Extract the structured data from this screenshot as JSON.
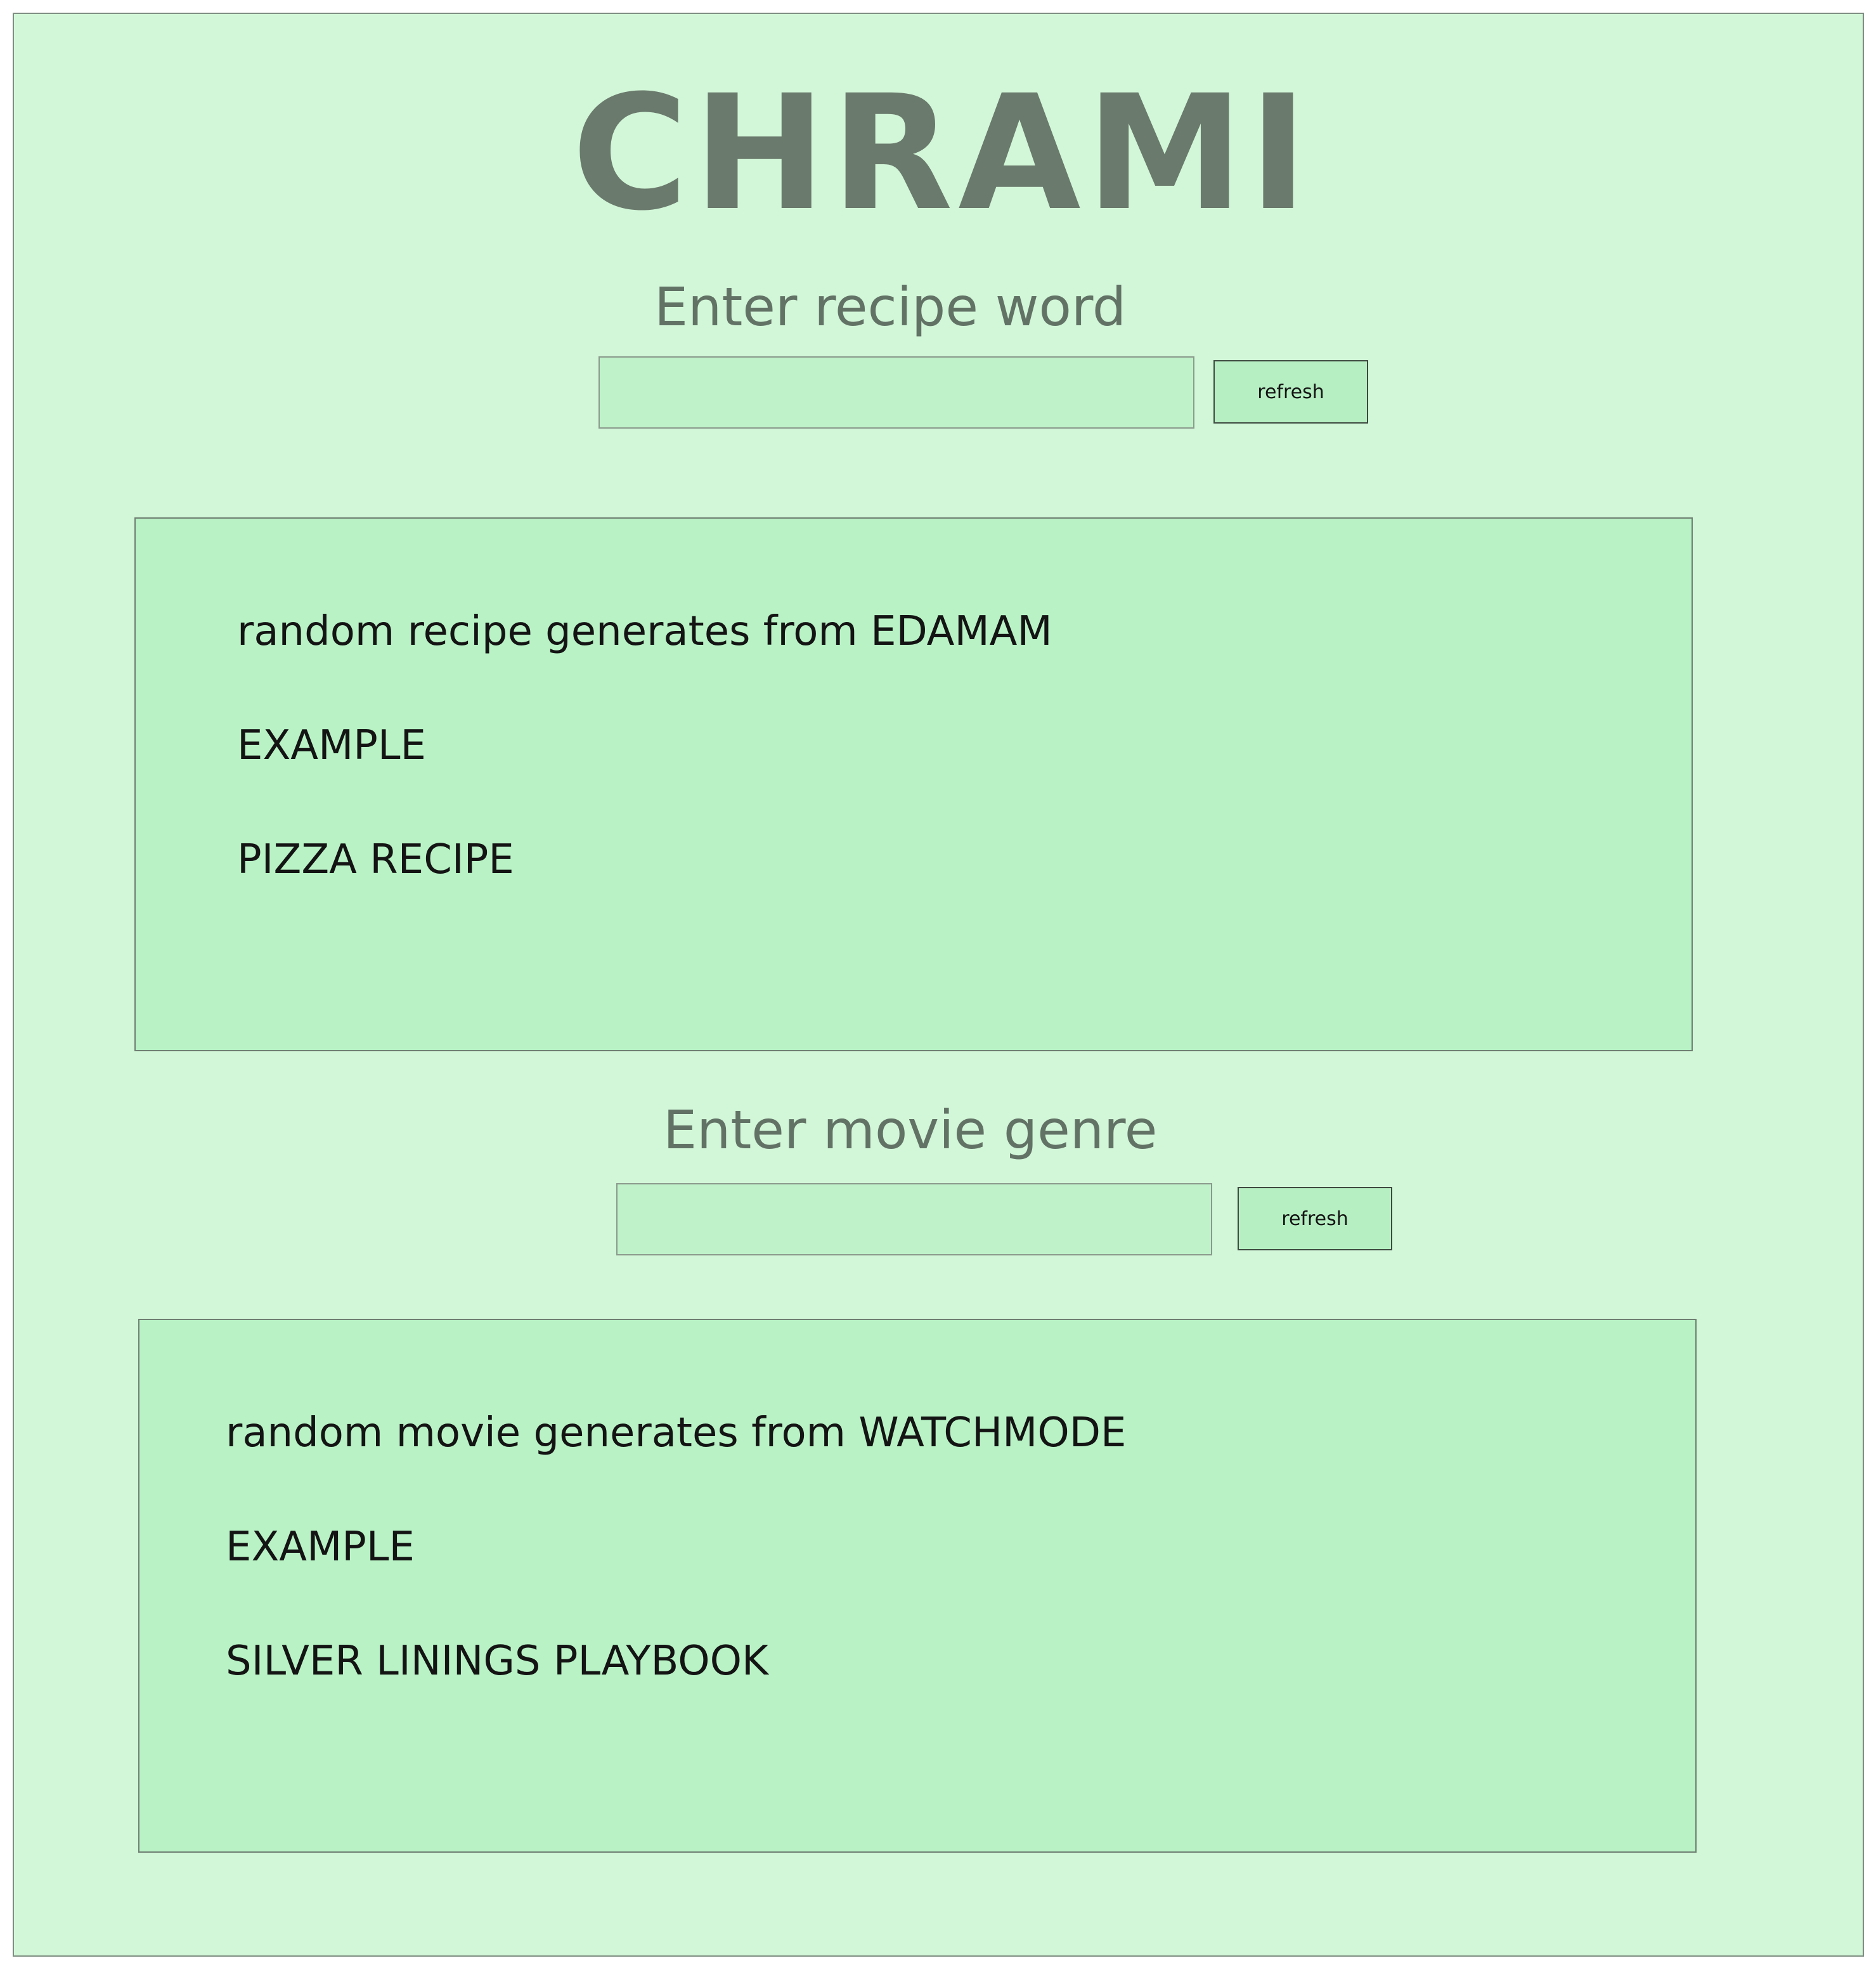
{
  "app": {
    "title": "CHRAMI"
  },
  "recipe": {
    "prompt": "Enter recipe word",
    "input_value": "",
    "refresh_label": "refresh",
    "description": "random recipe generates from EDAMAM",
    "example_label": "EXAMPLE",
    "example_value": "PIZZA RECIPE"
  },
  "movie": {
    "prompt": "Enter movie genre",
    "input_value": "",
    "refresh_label": "refresh",
    "description": "random movie generates from WATCHMODE",
    "example_label": "EXAMPLE",
    "example_value": "SILVER LININGS PLAYBOOK"
  }
}
